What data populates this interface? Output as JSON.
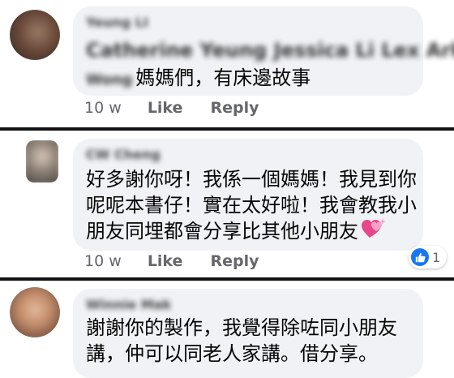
{
  "comments": [
    {
      "name": "Yeung LI",
      "tags_line1": "Catherine Yeung Jessica Li Lex Ark",
      "tags_line2_tag": "Wong",
      "text_line2": "媽媽們，有床邊故事",
      "time": "10 w",
      "like_label": "Like",
      "reply_label": "Reply"
    },
    {
      "name": "CW Cheng",
      "lines": [
        "好多謝你呀！我係一個媽媽！我見到你",
        "呢呢本書仔！實在太好啦！我會教我小",
        "朋友同埋都會分享比其他小朋友"
      ],
      "emoji": "sparkling-heart",
      "time": "10 w",
      "like_label": "Like",
      "reply_label": "Reply",
      "reaction_count": "1",
      "reaction_type": "like-icon"
    },
    {
      "name": "Winnie Mak",
      "lines": [
        "謝謝你的製作，我覺得除咗同小朋友",
        "講，仲可以同老人家講。借分享。"
      ]
    }
  ],
  "colors": {
    "bubble": "#f0f2f5",
    "meta": "#65676b",
    "like_blue": "#1877f2",
    "heart_pink": "#f25c9a"
  }
}
